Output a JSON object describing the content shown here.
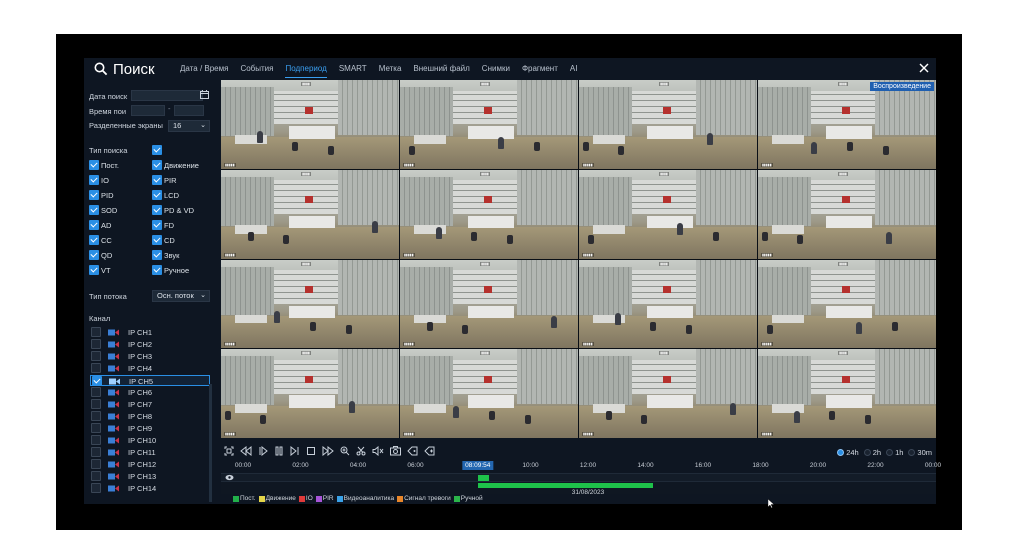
{
  "header": {
    "title": "Поиск",
    "tabs": [
      "Дата / Время",
      "События",
      "Подпериод",
      "SMART",
      "Метка",
      "Внешний файл",
      "Снимки",
      "Фрагмент",
      "AI"
    ],
    "active_tab": "Подпериод"
  },
  "panel": {
    "search_date_label": "Дата поиск",
    "search_time_label": "Время пои",
    "split_label": "Разделенные экраны",
    "split_value": "16",
    "search_type_label": "Тип поиска",
    "types": [
      {
        "label": "Пост.",
        "checked": true
      },
      {
        "label": "Движение",
        "checked": true
      },
      {
        "label": "IO",
        "checked": true
      },
      {
        "label": "PIR",
        "checked": true
      },
      {
        "label": "PID",
        "checked": true
      },
      {
        "label": "LCD",
        "checked": true
      },
      {
        "label": "SOD",
        "checked": true
      },
      {
        "label": "PD & VD",
        "checked": true
      },
      {
        "label": "AD",
        "checked": true
      },
      {
        "label": "FD",
        "checked": true
      },
      {
        "label": "CC",
        "checked": true
      },
      {
        "label": "CD",
        "checked": true
      },
      {
        "label": "QD",
        "checked": true
      },
      {
        "label": "Звук",
        "checked": true
      },
      {
        "label": "VT",
        "checked": true
      },
      {
        "label": "Ручное",
        "checked": true
      }
    ],
    "stream_label": "Тип потока",
    "stream_value": "Осн. поток",
    "channel_label": "Канал",
    "channels": [
      {
        "label": "IP CH1",
        "checked": false
      },
      {
        "label": "IP CH2",
        "checked": false
      },
      {
        "label": "IP CH3",
        "checked": false
      },
      {
        "label": "IP CH4",
        "checked": false
      },
      {
        "label": "IP CH5",
        "checked": true
      },
      {
        "label": "IP CH6",
        "checked": false
      },
      {
        "label": "IP CH7",
        "checked": false
      },
      {
        "label": "IP CH8",
        "checked": false
      },
      {
        "label": "IP CH9",
        "checked": false
      },
      {
        "label": "IP CH10",
        "checked": false
      },
      {
        "label": "IP CH11",
        "checked": false
      },
      {
        "label": "IP CH12",
        "checked": false
      },
      {
        "label": "IP CH13",
        "checked": false
      },
      {
        "label": "IP CH14",
        "checked": false
      }
    ]
  },
  "video": {
    "playback_label": "Воспроизведение",
    "cell_count": 16
  },
  "timeline": {
    "zoom_options": [
      {
        "label": "24h",
        "selected": true
      },
      {
        "label": "2h",
        "selected": false
      },
      {
        "label": "1h",
        "selected": false
      },
      {
        "label": "30m",
        "selected": false
      }
    ],
    "ticks": [
      "00:00",
      "02:00",
      "04:00",
      "06:00",
      "10:00",
      "12:00",
      "14:00",
      "16:00",
      "18:00",
      "20:00",
      "22:00",
      "00:00"
    ],
    "cursor_time": "08:09:54",
    "date": "31/08/2023",
    "segments": [
      {
        "start_hour": 8.16,
        "end_hour": 8.55,
        "row": "top"
      },
      {
        "start_hour": 8.16,
        "end_hour": 14.25,
        "row": "bottom"
      }
    ]
  },
  "legend": [
    {
      "label": "Пост.",
      "color": "#22b04a"
    },
    {
      "label": "Движение",
      "color": "#e5d64a"
    },
    {
      "label": "IO",
      "color": "#e03a3a"
    },
    {
      "label": "PIR",
      "color": "#a855d8"
    },
    {
      "label": "Видеоаналитика",
      "color": "#3aa2e8"
    },
    {
      "label": "Сигнал тревоги",
      "color": "#e8862a"
    },
    {
      "label": "Ручной",
      "color": "#2bb54a"
    }
  ]
}
